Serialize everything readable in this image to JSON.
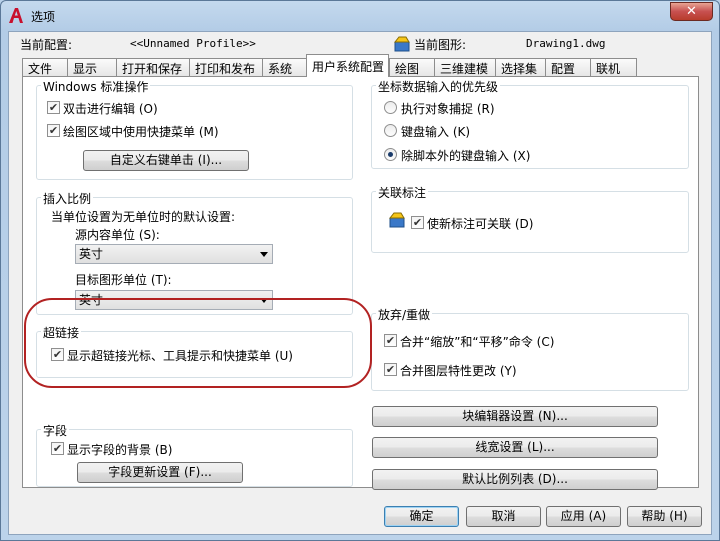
{
  "window": {
    "title": "选项",
    "app_icon": "autocad-a-icon",
    "close_icon": "close-icon"
  },
  "profile": {
    "current_profile_label": "当前配置:",
    "current_profile_value": "<<Unnamed Profile>>",
    "current_drawing_label": "当前图形:",
    "current_drawing_value": "Drawing1.dwg"
  },
  "tabs": [
    {
      "label": "文件"
    },
    {
      "label": "显示"
    },
    {
      "label": "打开和保存"
    },
    {
      "label": "打印和发布"
    },
    {
      "label": "系统"
    },
    {
      "label": "用户系统配置",
      "active": true
    },
    {
      "label": "绘图"
    },
    {
      "label": "三维建模"
    },
    {
      "label": "选择集"
    },
    {
      "label": "配置"
    },
    {
      "label": "联机"
    }
  ],
  "windows_ops": {
    "title": "Windows 标准操作",
    "double_click_edit": {
      "label": "双击进行编辑 (O)",
      "checked": true
    },
    "shortcut_menus": {
      "label": "绘图区域中使用快捷菜单 (M)",
      "checked": true
    },
    "custom_right_click_button": "自定义右键单击 (I)..."
  },
  "insert_scale": {
    "title": "插入比例",
    "subtitle": "当单位设置为无单位时的默认设置:",
    "source_units_label": "源内容单位 (S):",
    "source_units_value": "英寸",
    "target_units_label": "目标图形单位 (T):",
    "target_units_value": "英寸"
  },
  "hyperlink": {
    "title": "超链接",
    "show_cursor": {
      "label": "显示超链接光标、工具提示和快捷菜单 (U)",
      "checked": true
    }
  },
  "fields": {
    "title": "字段",
    "show_background": {
      "label": "显示字段的背景 (B)",
      "checked": true
    },
    "update_settings_button": "字段更新设置 (F)..."
  },
  "coordinate_priority": {
    "title": "坐标数据输入的优先级",
    "options": [
      {
        "label": "执行对象捕捉 (R)",
        "selected": false
      },
      {
        "label": "键盘输入 (K)",
        "selected": false
      },
      {
        "label": "除脚本外的键盘输入 (X)",
        "selected": true
      }
    ]
  },
  "associative_dim": {
    "title": "关联标注",
    "make_associative": {
      "label": "使新标注可关联 (D)",
      "checked": true
    }
  },
  "undo_redo": {
    "title": "放弃/重做",
    "combine_zoom_pan": {
      "label": "合并“缩放”和“平移”命令 (C)",
      "checked": true
    },
    "combine_layer_changes": {
      "label": "合并图层特性更改 (Y)",
      "checked": true
    }
  },
  "right_buttons": {
    "block_editor": "块编辑器设置 (N)...",
    "lineweight": "线宽设置 (L)...",
    "scale_list": "默认比例列表 (D)..."
  },
  "footer": {
    "ok": "确定",
    "cancel": "取消",
    "apply": "应用 (A)",
    "help": "帮助 (H)"
  },
  "colors": {
    "highlight": "#b22222",
    "title_bg": "#b9d1ea"
  }
}
